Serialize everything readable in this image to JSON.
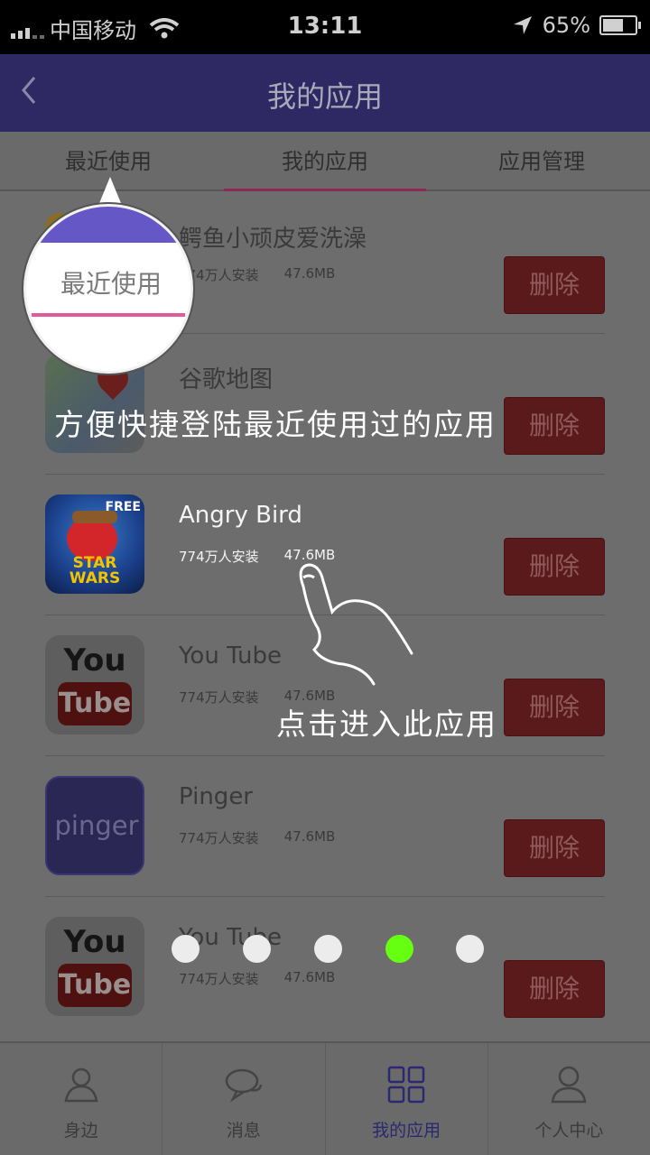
{
  "status_bar": {
    "carrier": "中国移动",
    "time": "13:11",
    "battery_text": "65%",
    "battery_level": 0.65
  },
  "header": {
    "back_icon": "chevron-left-icon",
    "title": "我的应用"
  },
  "tabs": [
    {
      "label": "最近使用",
      "active": false
    },
    {
      "label": "我的应用",
      "active": true
    },
    {
      "label": "应用管理",
      "active": false
    }
  ],
  "apps": [
    {
      "name": "鳄鱼小顽皮爱洗澡",
      "installs": "774万人安装",
      "size": "47.6MB",
      "action": "删除",
      "icon": "croc-icon"
    },
    {
      "name": "谷歌地图",
      "installs": "",
      "size": "",
      "action": "删除",
      "icon": "maps-icon"
    },
    {
      "name": "Angry Bird",
      "installs": "774万人安装",
      "size": "47.6MB",
      "action": "删除",
      "icon": "angry-birds-icon",
      "icon_badge": "FREE",
      "icon_title_1": "STAR",
      "icon_title_2": "WARS"
    },
    {
      "name": "You Tube",
      "installs": "774万人安装",
      "size": "47.6MB",
      "action": "删除",
      "icon": "youtube-icon",
      "icon_text_1": "You",
      "icon_text_2": "Tube"
    },
    {
      "name": "Pinger",
      "installs": "774万人安装",
      "size": "47.6MB",
      "action": "删除",
      "icon": "pinger-icon",
      "icon_text": "pinger"
    },
    {
      "name": "You Tube",
      "installs": "774万人安装",
      "size": "47.6MB",
      "action": "删除",
      "icon": "youtube-icon",
      "icon_text_1": "You",
      "icon_text_2": "Tube"
    }
  ],
  "overlay": {
    "spotlight_label": "最近使用",
    "hint_recent": "方便快捷登陆最近使用过的应用",
    "hint_tap": "点击进入此应用",
    "page_count": 5,
    "active_page": 4
  },
  "bottom_nav": [
    {
      "label": "身边",
      "icon": "person-icon"
    },
    {
      "label": "消息",
      "icon": "chat-icon"
    },
    {
      "label": "我的应用",
      "icon": "grid-icon",
      "active": true
    },
    {
      "label": "个人中心",
      "icon": "user-icon"
    }
  ]
}
